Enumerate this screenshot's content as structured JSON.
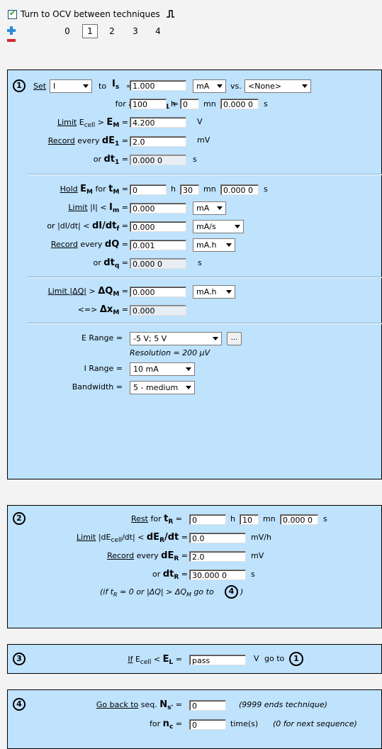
{
  "header": {
    "ocv_checked": true,
    "ocv_label": "Turn to OCV between techniques",
    "tabs": [
      "0",
      "1",
      "2",
      "3",
      "4"
    ],
    "selected_tab": "1"
  },
  "seq1": {
    "num": "1",
    "set_link": "Set",
    "set_value": "I",
    "to_word": "to",
    "is_sym": "I",
    "is_sub": "s",
    "is_value": "1.000",
    "is_unit": "mA",
    "vs_label": "vs.",
    "vs_value": "<None>",
    "forat_text": "for at most",
    "t1_sym": "t",
    "t1_sub": "1",
    "t1_h": "100",
    "t1_mn": "0",
    "t1_s": "0.000 0",
    "limit_link": "Limit",
    "ecell_text": "E",
    "ecell_sub": "cell",
    "gt": ">",
    "em_sym": "E",
    "em_sub": "M",
    "em_value": "4.200",
    "em_unit": "V",
    "record_link": "Record",
    "every_text": "every",
    "de1_sym": "dE",
    "de1_sub": "1",
    "de1_value": "2.0",
    "de1_unit": "mV",
    "or_text": "or",
    "dt1_sym": "dt",
    "dt1_sub": "1",
    "dt1_value": "0.000 0",
    "dt1_unit": "s",
    "hold_link": "Hold",
    "hold_em": "E",
    "hold_em_sub": "M",
    "for_text": "for",
    "tm_sym": "t",
    "tm_sub": "M",
    "tm_h": "0",
    "tm_mn": "30",
    "tm_s": "0.000 0",
    "lim2_link": "Limit",
    "absi_text": "|I| <",
    "im_sym": "I",
    "im_sub": "m",
    "im_value": "0.000",
    "im_unit": "mA",
    "or2_text": "or |dI/dt| <",
    "didt_sym": "dI/dt",
    "didt_sub": "f",
    "didt_value": "0.000",
    "didt_unit": "mA/s",
    "rec2_link": "Record",
    "dq_sym": "dQ",
    "dq_value": "0.001",
    "dq_unit": "mA.h",
    "dtq_sym": "dt",
    "dtq_sub": "q",
    "dtq_value": "0.000 0",
    "dtq_unit": "s",
    "lim3_link": "Limit |ΔQ|",
    "dqm_sym": "ΔQ",
    "dqm_sub": "M",
    "dqm_value": "0.000",
    "dqm_unit": "mA.h",
    "equiv": "<=>",
    "dxm_sym": "Δx",
    "dxm_sub": "M",
    "dxm_value": "0.000",
    "erange_label": "E Range =",
    "erange_value": "-5 V; 5 V",
    "erange_btn": "...",
    "resolution": "Resolution = 200 µV",
    "irange_label": "I Range =",
    "irange_value": "10 mA",
    "bw_label": "Bandwidth =",
    "bw_value": "5 - medium",
    "h": "h",
    "mn": "mn",
    "s": "s",
    "eq": "="
  },
  "seq2": {
    "num": "2",
    "rest_link": "Rest",
    "for_text": "for",
    "tr_sym": "t",
    "tr_sub": "R",
    "tr_h": "0",
    "tr_mn": "10",
    "tr_s": "0.000 0",
    "limit_link": "Limit",
    "dedt_text": "|dE",
    "dedt_sub": "cell",
    "dedt_tail": "/dt| <",
    "der_sym": "dE",
    "der_sub": "R",
    "der_tail": "/dt",
    "der_value": "0.0",
    "der_unit": "mV/h",
    "record_link": "Record",
    "every_text": "every",
    "der2_sym": "dE",
    "der2_sub": "R",
    "der2_value": "2.0",
    "der2_unit": "mV",
    "or_text": "or",
    "dtr_sym": "dt",
    "dtr_sub": "R",
    "dtr_value": "30.000 0",
    "dtr_unit": "s",
    "note_pre": "(if t",
    "note_sub": "R",
    "note_mid": " = 0 or |ΔQ| > ΔQ",
    "note_sub2": "M",
    "note_post": "  go to",
    "note_goto": "4",
    "note_close": ")"
  },
  "seq3": {
    "num": "3",
    "if_link": "If",
    "ecell_text": "E",
    "ecell_sub": "cell",
    "lt": "<",
    "el_sym": "E",
    "el_sub": "L",
    "el_value": "pass",
    "el_unit": "V",
    "goto_text": "go to",
    "goto_num": "1"
  },
  "seq4": {
    "num": "4",
    "goback_link": "Go back to",
    "seq_text": "seq.",
    "ns_sym": "N",
    "ns_sub": "s'",
    "ns_value": "0",
    "ns_note": "(9999 ends technique)",
    "for_text": "for",
    "nc_sym": "n",
    "nc_sub": "c",
    "nc_value": "0",
    "nc_unit": "time(s)",
    "nc_note": "(0 for next sequence)"
  }
}
